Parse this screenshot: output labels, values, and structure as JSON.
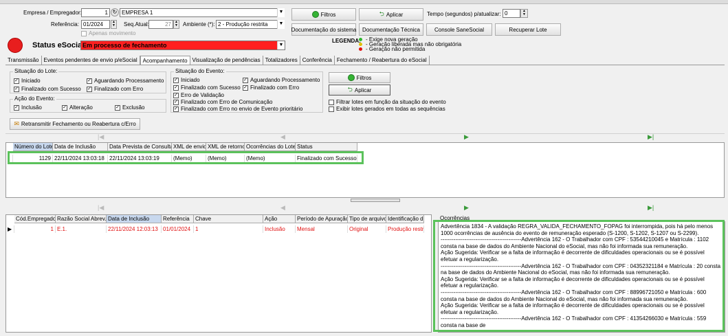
{
  "header": {
    "empresa_label": "Empresa / Empregador:",
    "empresa_code": "1",
    "empresa_name": "EMPRESA 1",
    "referencia_label": "Referência:",
    "referencia_value": "01/2024",
    "seq_label": "Seq.Atual:",
    "seq_value": "27",
    "ambiente_label": "Ambiente (*):",
    "ambiente_value": "2 - Produção restrita",
    "apenas_label": "Apenas movimento",
    "status_label": "Status eSocial:",
    "status_value": "Em processo de fechamento",
    "tempo_label": "Tempo (segundos) p/atualizar:",
    "tempo_value": "0"
  },
  "buttons": {
    "filtros": "Filtros",
    "aplicar": "Aplicar",
    "doc_sistema": "Documentação do sistema",
    "doc_tecnica": "Documentação Técnica",
    "console": "Console SaneSocial",
    "recuperar": "Recuperar Lote",
    "retransmitir": "Retransmitir Fechamento ou Reabertura c/Erro"
  },
  "legend": {
    "title": "LEGENDA:",
    "items": [
      {
        "text": "- Exige nova geração",
        "color": "#2db52d"
      },
      {
        "text": "- Geração liberada mas não obrigatória",
        "color": "#e0c000"
      },
      {
        "text": "- Geração não permitida",
        "color": "#e01010"
      }
    ]
  },
  "tabs": [
    "Transmissão",
    "Eventos pendentes de envio p/eSocial",
    "Acompanhamento",
    "Visualização de pendências",
    "Totalizadores",
    "Conferência",
    "Fechamento / Reabertura do eSocial"
  ],
  "active_tab": "Acompanhamento",
  "situacao_lote": {
    "title": "Situação do Lote:",
    "items": [
      "Iniciado",
      "Aguardando Processamento",
      "Finalizado com Sucesso",
      "Finalizado com Erro"
    ]
  },
  "acao_evento": {
    "title": "Ação do Evento:",
    "items": [
      "Inclusão",
      "Alteração",
      "Exclusão"
    ]
  },
  "situacao_evento": {
    "title": "Situação do  Evento:",
    "items": [
      "Iniciado",
      "Aguardando Processamento",
      "Finalizado com Sucesso",
      "Finalizado com Erro",
      "Erro de Validação",
      "Finalizado com Erro de Comunicação",
      "Finalizado com Erro no envio de Evento prioritário"
    ]
  },
  "filters": {
    "filtrar_lotes": "Filtrar lotes em função da situação do evento",
    "exibir_lotes": "Exibir lotes gerados em todas as sequências"
  },
  "lotes_grid": {
    "columns": [
      "Número do Lote",
      "Data de Inclusão",
      "Data Prevista de Consulta",
      "XML de envio",
      "XML de retorno",
      "Ocorrências do Lote",
      "Status"
    ],
    "row": [
      "1129",
      "22/11/2024 13:03:18",
      "22/11/2024 13:03:19",
      "(Memo)",
      "(Memo)",
      "(Memo)",
      "Finalizado com Sucesso"
    ]
  },
  "eventos_grid": {
    "columns": [
      "Cód.Empregador",
      "Razão Social Abrev.",
      "Data de Inclusão",
      "Referência",
      "Chave",
      "Ação",
      "Período de Apuração",
      "Tipo de arquivo",
      "Identificação d"
    ],
    "row": [
      "1",
      "E.1.",
      "22/11/2024 12:03:13",
      "01/01/2024",
      "1",
      "Inclusão",
      "Mensal",
      "Original",
      "Produção restri"
    ]
  },
  "ocorrencias": {
    "title": "Ocorrências",
    "paragraphs": [
      "Advertência 1834 - A validação REGRA_VALIDA_FECHAMENTO_FOPAG foi interrompida, pois há pelo menos 1000 ocorrências de ausência do evento de remuneração esperado (S-1200, S-1202, S-1207 ou S-2299).",
      "--------------------------------------------Advertência 162 - O Trabalhador com CPF : 53544210045 e Matrícula : 1102 consta na base de dados do Ambiente Nacional do eSocial, mas não foi informada sua remuneração.",
      "Ação Sugerida: Verificar se a falta de informação é decorrente de dificuldades operacionais ou se é possível efetuar a regularização.",
      "--------------------------------------------Advertência 162 - O Trabalhador com CPF : 04352321184 e Matrícula : 20 consta na base de dados do Ambiente Nacional do eSocial, mas não foi informada sua remuneração.",
      "Ação Sugerida: Verificar se a falta de informação é decorrente de dificuldades operacionais ou se é possível efetuar a regularização.",
      "--------------------------------------------Advertência 162 - O Trabalhador com CPF : 88996721050 e Matrícula : 600 consta na base de dados do Ambiente Nacional do eSocial, mas não foi informada sua remuneração.",
      "Ação Sugerida: Verificar se a falta de informação é decorrente de dificuldades operacionais ou se é possível efetuar a regularização.",
      "--------------------------------------------Advertência 162 - O Trabalhador com CPF : 41354266030 e Matrícula : 559 consta na base de"
    ]
  }
}
